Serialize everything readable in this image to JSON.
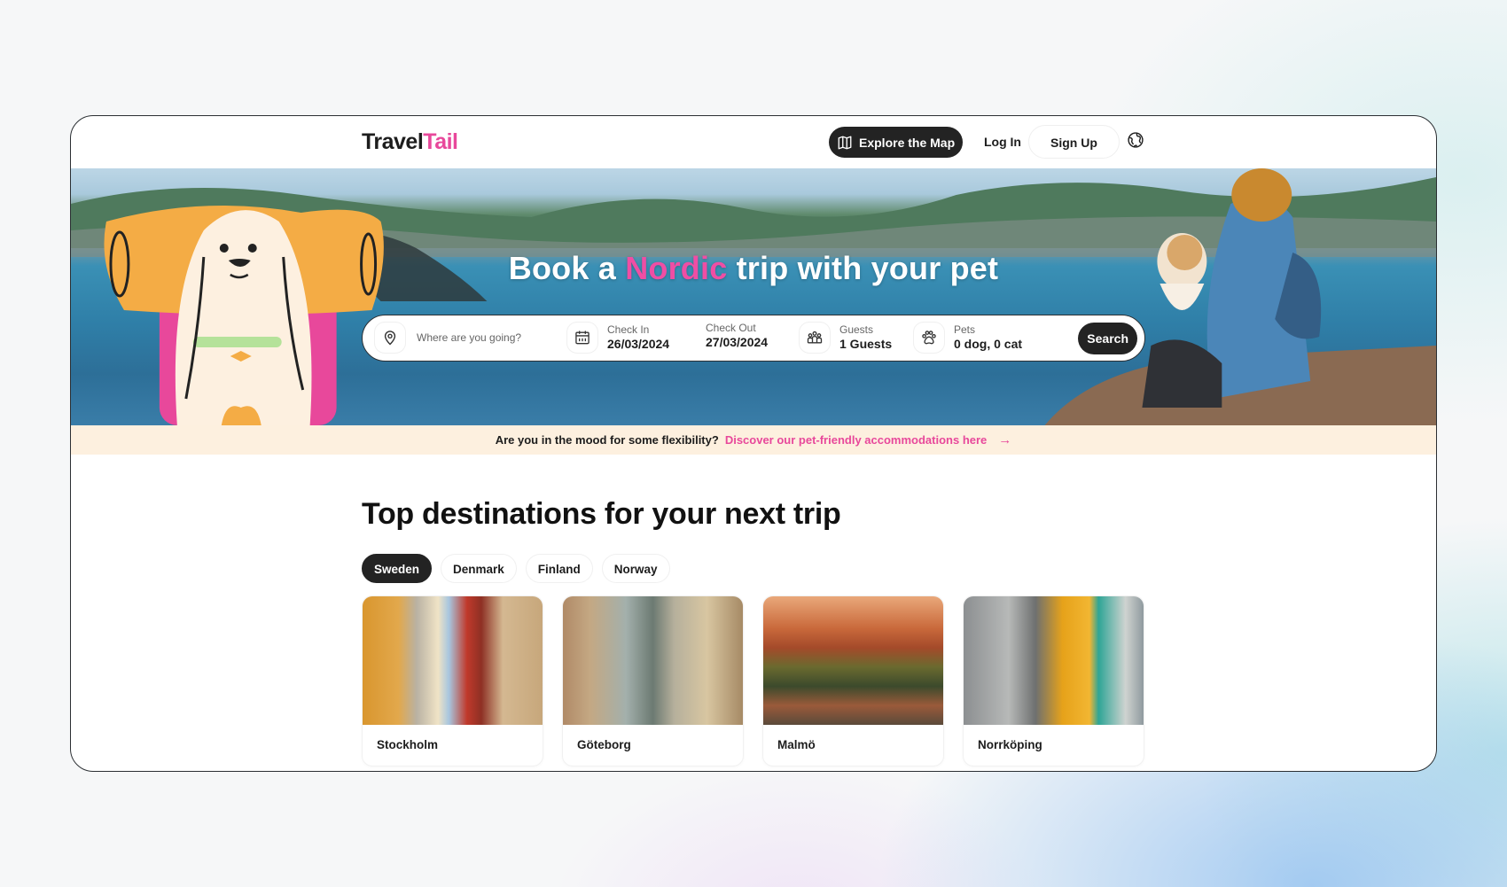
{
  "nav": {
    "logo_main": "Travel",
    "logo_accent": "Tail",
    "explore_map_label": "Explore the Map",
    "login_label": "Log In",
    "signup_label": "Sign Up",
    "language_icon": "globe-icon"
  },
  "hero": {
    "title_before": "Book a ",
    "title_highlight": "Nordic",
    "title_after": " trip with your pet",
    "search": {
      "destination_placeholder": "Where are you going?",
      "destination_value": "",
      "check_in_label": "Check In",
      "check_in_value": "26/03/2024",
      "check_out_label": "Check Out",
      "check_out_value": "27/03/2024",
      "guests_label": "Guests",
      "guests_value": "1 Guests",
      "pets_label": "Pets",
      "pets_value": "0 dog, 0 cat",
      "search_button": "Search"
    }
  },
  "flex_banner": {
    "question": "Are you in the mood for some flexibility?",
    "link": "Discover our pet-friendly accommodations here",
    "arrow": "→"
  },
  "destinations": {
    "title": "Top destinations for your next trip",
    "tabs": [
      {
        "label": "Sweden",
        "active": true
      },
      {
        "label": "Denmark",
        "active": false
      },
      {
        "label": "Finland",
        "active": false
      },
      {
        "label": "Norway",
        "active": false
      }
    ],
    "cards": [
      {
        "name": "Stockholm"
      },
      {
        "name": "Göteborg"
      },
      {
        "name": "Malmö"
      },
      {
        "name": "Norrköping"
      }
    ]
  },
  "colors": {
    "brand_pink": "#e8489b",
    "dark_button": "#232323",
    "banner_bg": "#fdf0df"
  }
}
